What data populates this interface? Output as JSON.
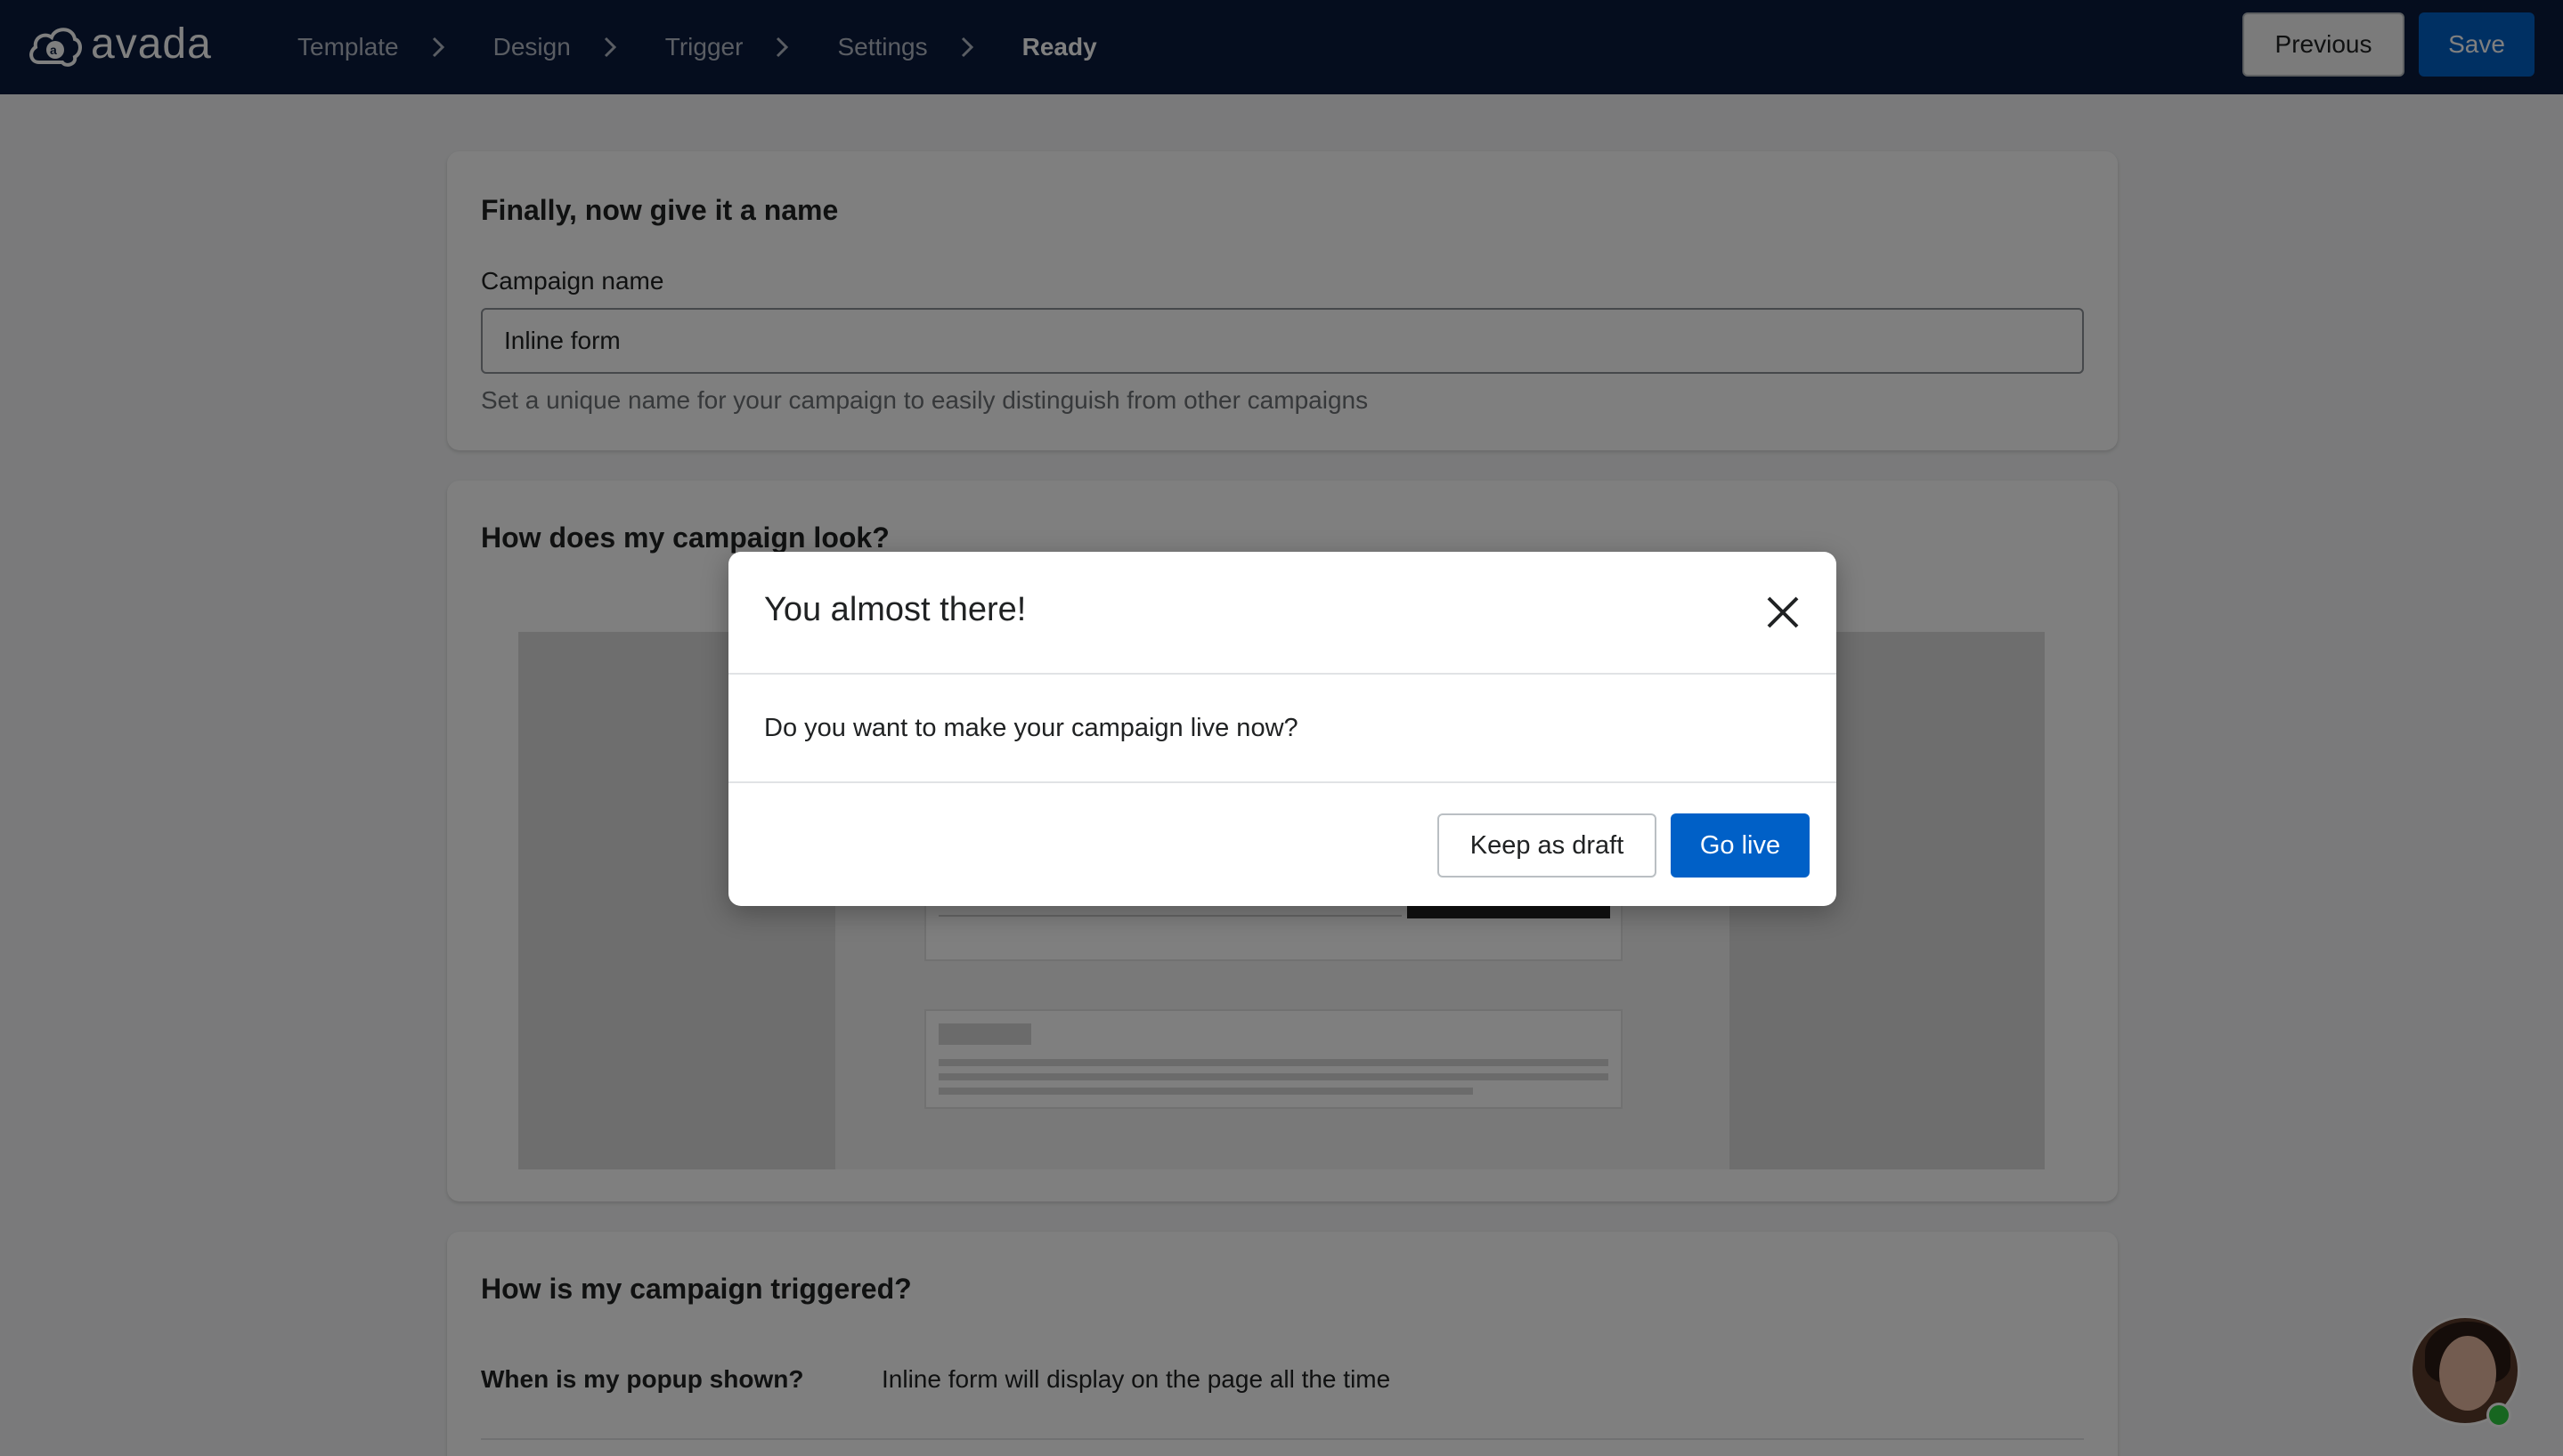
{
  "app": {
    "brand": "avada"
  },
  "nav": {
    "steps": [
      {
        "label": "Template"
      },
      {
        "label": "Design"
      },
      {
        "label": "Trigger"
      },
      {
        "label": "Settings"
      },
      {
        "label": "Ready"
      }
    ],
    "previous_label": "Previous",
    "save_label": "Save"
  },
  "name_card": {
    "title": "Finally, now give it a name",
    "field_label": "Campaign name",
    "field_value": "Inline form",
    "help_text": "Set a unique name for your campaign to easily distinguish from other campaigns"
  },
  "look_card": {
    "title": "How does my campaign look?"
  },
  "trigger_card": {
    "title": "How is my campaign triggered?",
    "row_label": "When is my popup shown?",
    "row_value": "Inline form will display on the page all the time"
  },
  "modal": {
    "title": "You almost there!",
    "body": "Do you want to make your campaign live now?",
    "draft_label": "Keep as draft",
    "live_label": "Go live"
  },
  "colors": {
    "topbar": "#0a1b3d",
    "primary": "#0060c7",
    "online": "#2ecc40"
  }
}
